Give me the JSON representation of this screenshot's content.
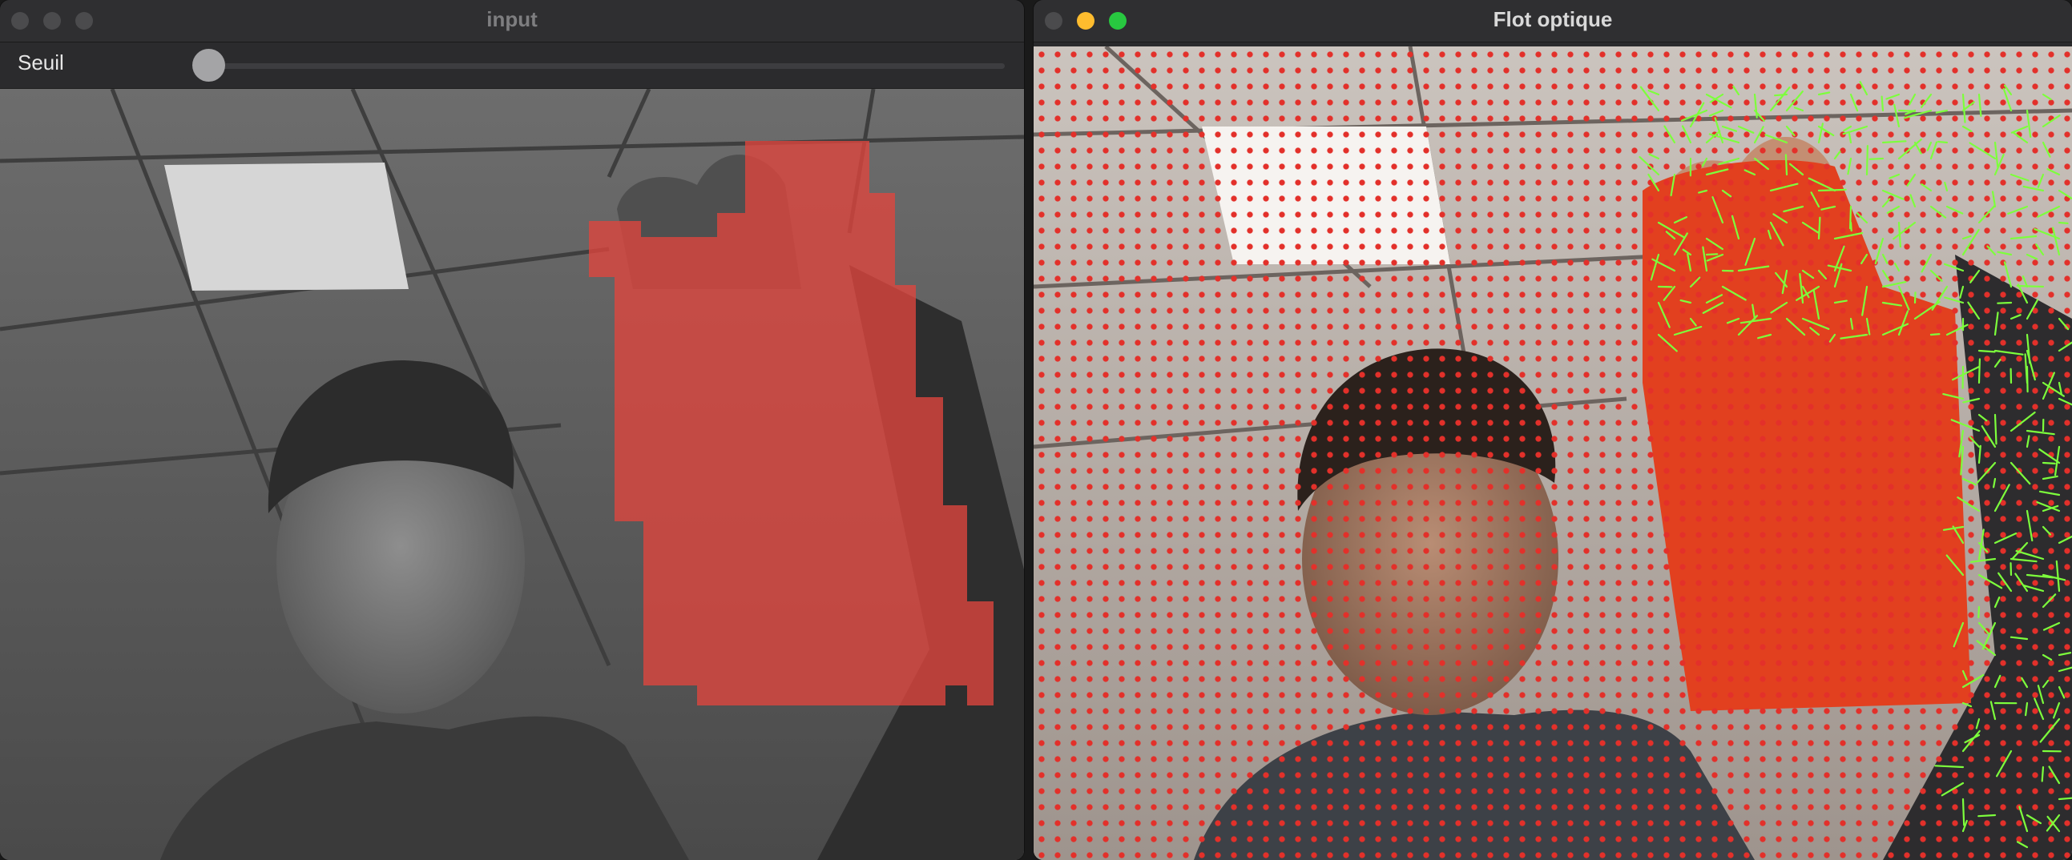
{
  "windows": {
    "input": {
      "title": "input",
      "slider": {
        "label": "Seuil",
        "value_fraction": 0.0
      }
    },
    "flow": {
      "title": "Flot optique"
    }
  },
  "colors": {
    "mask_overlay": "#e0453e",
    "flow_dot": "#e3302a",
    "flow_vector": "#7dff3c",
    "traffic_close": "#ff5f57",
    "traffic_minimize": "#febc2e",
    "traffic_zoom": "#28c840",
    "traffic_inactive": "#4b4b4d"
  },
  "icons": {
    "window_controls": [
      "close-icon",
      "minimize-icon",
      "zoom-icon"
    ]
  }
}
